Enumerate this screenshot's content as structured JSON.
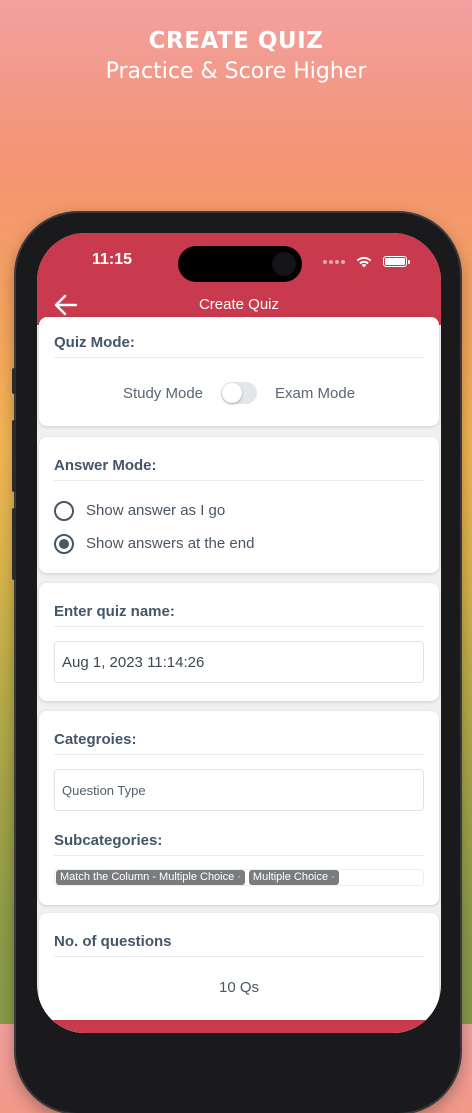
{
  "promo": {
    "title": "CREATE QUIZ",
    "subtitle": "Practice & Score Higher"
  },
  "status_bar": {
    "time": "11:15"
  },
  "nav": {
    "title": "Create Quiz",
    "back_icon": "arrow-left-icon"
  },
  "quiz_mode": {
    "title": "Quiz Mode:",
    "left_label": "Study Mode",
    "right_label": "Exam Mode",
    "toggle_on": false
  },
  "answer_mode": {
    "title": "Answer Mode:",
    "options": [
      {
        "label": "Show answer as I go",
        "selected": false
      },
      {
        "label": "Show answers at the end",
        "selected": true
      }
    ]
  },
  "quiz_name": {
    "title": "Enter quiz name:",
    "value": "Aug 1, 2023 11:14:26"
  },
  "categories": {
    "title": "Categroies:",
    "value": "Question Type",
    "subcategories_title": "Subcategories:",
    "subcategories": [
      {
        "label": "Match the Column - Multiple Choice",
        "remove": "·"
      },
      {
        "label": "Multiple Choice",
        "remove": "·"
      }
    ]
  },
  "questions": {
    "title": "No. of questions",
    "value": "10 Qs"
  },
  "colors": {
    "header": "#c93a4f",
    "text_dark": "#44566a"
  }
}
